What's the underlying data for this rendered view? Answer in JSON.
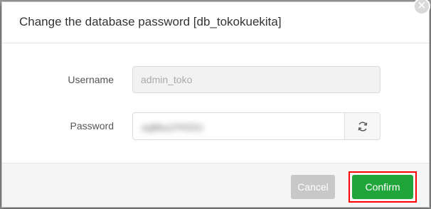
{
  "dialog": {
    "title": "Change the database password [db_tokokuekita]",
    "close_icon": "close-icon",
    "username_label": "Username",
    "username_value": "admin_toko",
    "password_label": "Password",
    "password_value": "sq8kuiJYKDU",
    "refresh_icon": "refresh-icon",
    "cancel_label": "Cancel",
    "confirm_label": "Confirm"
  },
  "colors": {
    "confirm_green": "#20a53a",
    "highlight_red": "#ff0000",
    "cancel_gray": "#c8c8c8"
  }
}
